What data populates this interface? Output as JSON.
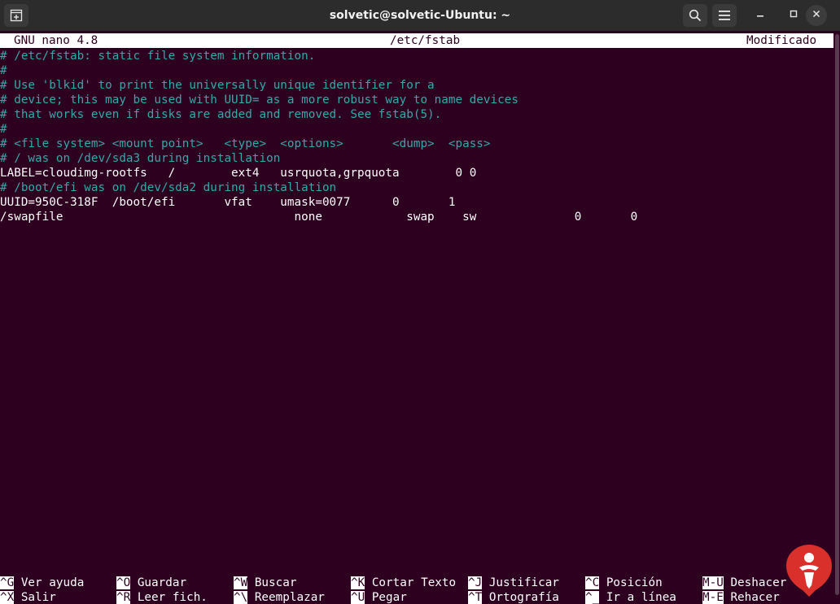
{
  "window": {
    "title": "solvetic@solvetic-Ubuntu: ~"
  },
  "titlebar_icons": {
    "new_tab": "new-tab-icon",
    "search": "search-icon",
    "menu": "hamburger-menu-icon",
    "minimize": "minimize-icon",
    "maximize": "maximize-icon",
    "close": "close-icon"
  },
  "nano": {
    "version": "GNU nano 4.8",
    "filename": "/etc/fstab",
    "status": "Modificado"
  },
  "file_lines": [
    {
      "text": "# /etc/fstab: static file system information.",
      "kind": "comment"
    },
    {
      "text": "#",
      "kind": "comment"
    },
    {
      "text": "# Use 'blkid' to print the universally unique identifier for a",
      "kind": "comment"
    },
    {
      "text": "# device; this may be used with UUID= as a more robust way to name devices",
      "kind": "comment"
    },
    {
      "text": "# that works even if disks are added and removed. See fstab(5).",
      "kind": "comment"
    },
    {
      "text": "#",
      "kind": "comment"
    },
    {
      "text": "# <file system> <mount point>   <type>  <options>       <dump>  <pass>",
      "kind": "comment"
    },
    {
      "text": "# / was on /dev/sda3 during installation",
      "kind": "comment"
    },
    {
      "text": "LABEL=cloudimg-rootfs   /        ext4   usrquota,grpquota        0 0",
      "kind": "normal"
    },
    {
      "text": "# /boot/efi was on /dev/sda2 during installation",
      "kind": "comment"
    },
    {
      "text": "UUID=950C-318F  /boot/efi       vfat    umask=0077      0       1",
      "kind": "normal"
    },
    {
      "text": "/swapfile                                 none            swap    sw              0       0",
      "kind": "normal"
    }
  ],
  "shortcuts": {
    "row1": [
      {
        "key": "^G",
        "label": "Ver ayuda"
      },
      {
        "key": "^O",
        "label": "Guardar"
      },
      {
        "key": "^W",
        "label": "Buscar"
      },
      {
        "key": "^K",
        "label": "Cortar Texto"
      },
      {
        "key": "^J",
        "label": "Justificar"
      },
      {
        "key": "^C",
        "label": "Posición"
      },
      {
        "key": "M-U",
        "label": "Deshacer"
      }
    ],
    "row2": [
      {
        "key": "^X",
        "label": "Salir"
      },
      {
        "key": "^R",
        "label": "Leer fich."
      },
      {
        "key": "^\\",
        "label": "Reemplazar"
      },
      {
        "key": "^U",
        "label": "Pegar"
      },
      {
        "key": "^T",
        "label": "Ortografía"
      },
      {
        "key": "^_",
        "label": "Ir a línea"
      },
      {
        "key": "M-E",
        "label": "Rehacer"
      }
    ]
  },
  "colors": {
    "terminal_bg": "#2c001e",
    "comment": "#35a9a9",
    "text": "#ffffff",
    "titlebar_bg": "#2c2c2c",
    "watermark_red": "#d9302c"
  },
  "watermark": "solvetic-logo"
}
